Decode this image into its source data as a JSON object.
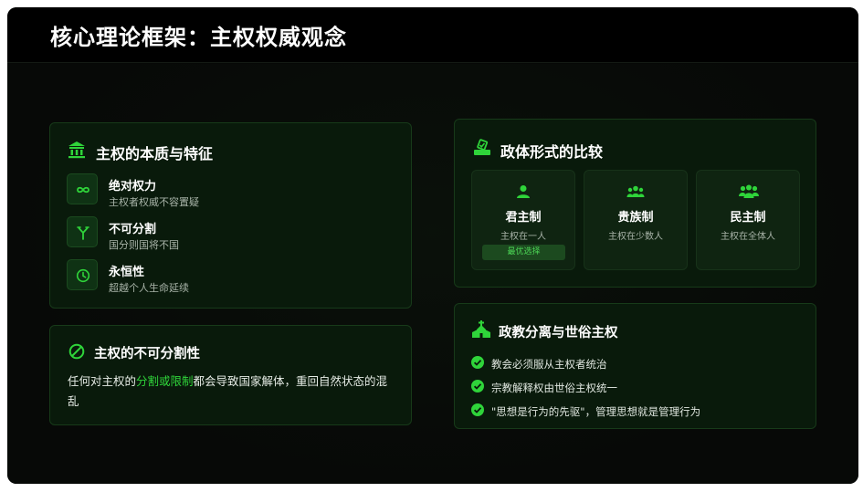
{
  "header": {
    "title": "核心理论框架：主权权威观念"
  },
  "sovereignty_card": {
    "title": "主权的本质与特征",
    "icon": "bank-icon",
    "features": [
      {
        "icon": "infinity-icon",
        "title": "绝对权力",
        "desc": "主权者权威不容置疑"
      },
      {
        "icon": "fork-icon",
        "title": "不可分割",
        "desc": "国分则国将不国"
      },
      {
        "icon": "clock-icon",
        "title": "永恒性",
        "desc": "超越个人生命延续"
      }
    ]
  },
  "indivisibility_card": {
    "title": "主权的不可分割性",
    "icon": "ban-icon",
    "text_before": "任何对主权的",
    "highlight": "分割或限制",
    "text_after": "都会导致国家解体，重回自然状态的混乱"
  },
  "government_card": {
    "title": "政体形式的比较",
    "icon": "vote-icon",
    "forms": [
      {
        "icon": "user-icon",
        "title": "君主制",
        "desc": "主权在一人",
        "badge": "最优选择"
      },
      {
        "icon": "users-icon",
        "title": "贵族制",
        "desc": "主权在少数人"
      },
      {
        "icon": "people-group-icon",
        "title": "民主制",
        "desc": "主权在全体人"
      }
    ]
  },
  "church_card": {
    "title": "政教分离与世俗主权",
    "icon": "church-icon",
    "items": [
      "教会必须服从主权者统治",
      "宗教解释权由世俗主权统一",
      "\"思想是行为的先驱\"，管理思想就是管理行为"
    ]
  },
  "colors": {
    "accent": "#2fd43a",
    "card_bg": "#091a0b",
    "card_border": "#173a19"
  }
}
